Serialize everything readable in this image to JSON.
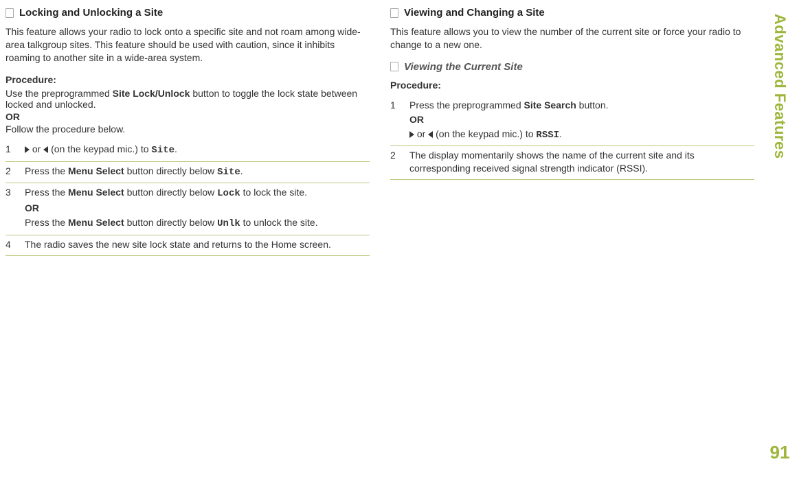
{
  "sidebar": {
    "title": "Advanced Features",
    "page": "91"
  },
  "left": {
    "heading": "Locking and Unlocking a Site",
    "intro": "This feature allows your radio to lock onto a specific site and not roam among wide-area talkgroup sites. This feature should be used with caution, since it inhibits roaming to another site in a wide-area system.",
    "proc_label": "Procedure:",
    "pre_text1": "Use the preprogrammed ",
    "pre_bold": "Site Lock/Unlock",
    "pre_text2": " button to toggle the lock state between locked and unlocked.",
    "or": "OR",
    "follow": "Follow the procedure below.",
    "step1_a": " or ",
    "step1_b": " (on the keypad mic.) to ",
    "step1_mono": "Site",
    "step1_c": ".",
    "step2_a": "Press the ",
    "step2_b": "Menu Select",
    "step2_c": " button directly below ",
    "step2_mono": "Site",
    "step2_d": ".",
    "step3_a": "Press the ",
    "step3_b": "Menu Select",
    "step3_c": " button directly below ",
    "step3_mono1": "Lock",
    "step3_d": " to lock the site.",
    "step3_or": "OR",
    "step3_e": "Press the ",
    "step3_f": "Menu Select",
    "step3_g": " button directly below ",
    "step3_mono2": "Unlk",
    "step3_h": " to unlock the site.",
    "step4": "The radio saves the new site lock state and returns to the Home screen."
  },
  "right": {
    "heading": "Viewing and Changing a Site",
    "intro": "This feature allows you to view the number of the current site or force your radio to change to a new one.",
    "sub_heading": "Viewing the Current Site",
    "proc_label": "Procedure:",
    "step1_a": "Press the preprogrammed ",
    "step1_b": "Site Search",
    "step1_c": " button.",
    "step1_or": "OR",
    "step1_d": " or ",
    "step1_e": " (on the keypad mic.) to ",
    "step1_mono": "RSSI",
    "step1_f": ".",
    "step2": "The display momentarily shows the name of the current site and its corresponding received signal strength indicator (RSSI)."
  }
}
